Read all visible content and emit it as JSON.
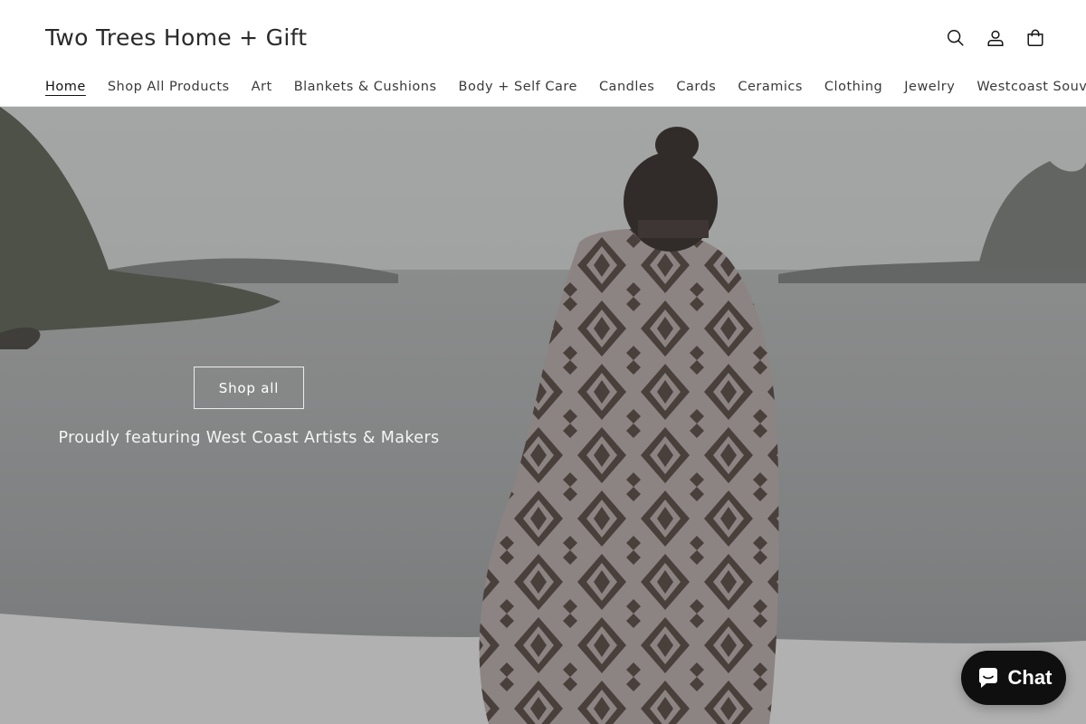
{
  "store": {
    "name": "Two Trees Home + Gift"
  },
  "header": {
    "icons": [
      "search-icon",
      "account-icon",
      "cart-icon"
    ]
  },
  "nav": {
    "items": [
      {
        "label": "Home"
      },
      {
        "label": "Shop All Products"
      },
      {
        "label": "Art"
      },
      {
        "label": "Blankets & Cushions"
      },
      {
        "label": "Body + Self Care"
      },
      {
        "label": "Candles"
      },
      {
        "label": "Cards"
      },
      {
        "label": "Ceramics"
      },
      {
        "label": "Clothing"
      },
      {
        "label": "Jewelry"
      },
      {
        "label": "Westcoast Souvenir"
      }
    ],
    "active_index": 0
  },
  "hero": {
    "button_label": "Shop all",
    "tagline": "Proudly featuring West Coast Artists & Makers"
  },
  "chat": {
    "label": "Chat",
    "icon": "chat-bubble-icon",
    "background": "#0f0f0f"
  },
  "colors": {
    "text": "#121212",
    "header_bg": "#ffffff",
    "hero_text": "#ffffff"
  }
}
